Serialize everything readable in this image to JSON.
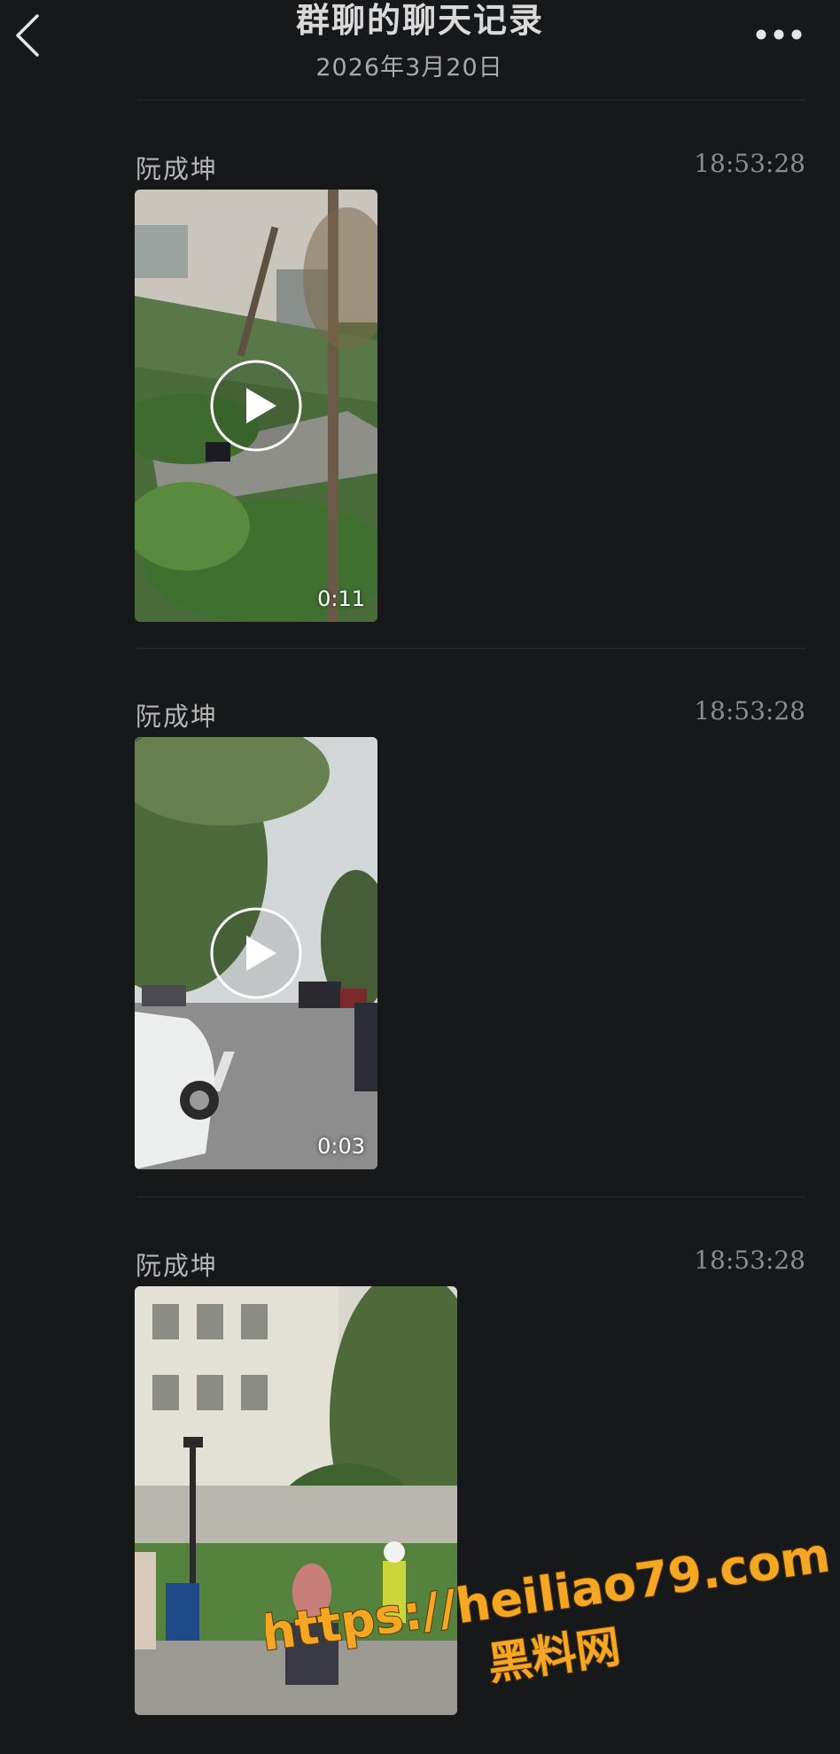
{
  "header": {
    "title": "群聊的聊天记录",
    "date": "2026年3月20日"
  },
  "messages": [
    {
      "sender": "阮成坤",
      "time": "18:53:28",
      "type": "video",
      "duration": "0:11"
    },
    {
      "sender": "阮成坤",
      "time": "18:53:28",
      "type": "video",
      "duration": "0:03"
    },
    {
      "sender": "阮成坤",
      "time": "18:53:28",
      "type": "video",
      "duration": ""
    }
  ],
  "watermark": {
    "url": "https://heiliao79.com",
    "text": "黑料网",
    "color": "#f5a623"
  },
  "icons": {
    "back": "chevron-left-icon",
    "more": "more-dots-icon",
    "play": "play-circle-icon"
  }
}
